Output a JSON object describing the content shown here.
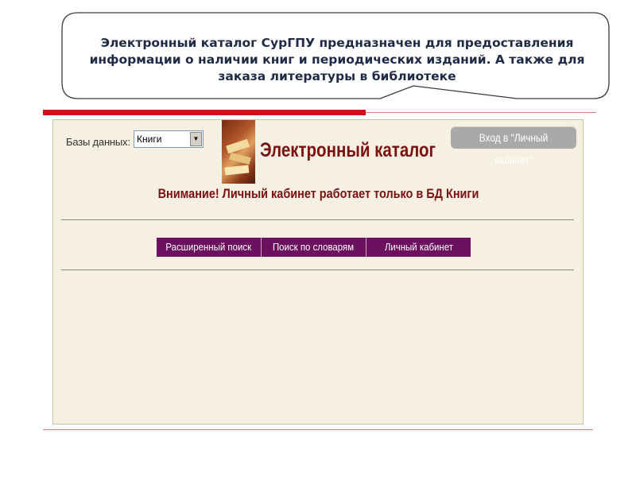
{
  "callout": {
    "text": "Электронный каталог СурГПУ предназначен для предоставления информации о наличии книг и периодических изданий. А также для заказа литературы в библиотеке"
  },
  "catalog": {
    "db_label": "Базы данных:",
    "db_select_value": "Книги",
    "title": "Электронный каталог",
    "login_button": "Вход в \"Личный кабинет\"",
    "notice": "Внимание! Личный кабинет работает только в БД Книги",
    "nav": [
      {
        "label": "Расширенный поиск"
      },
      {
        "label": "Поиск по словарям"
      },
      {
        "label": "Личный кабинет"
      }
    ]
  },
  "colors": {
    "accent_red": "#c8161d",
    "nav_purple": "#6b0f5e",
    "title_red": "#7a1010",
    "panel_bg": "#f5f0e1"
  }
}
